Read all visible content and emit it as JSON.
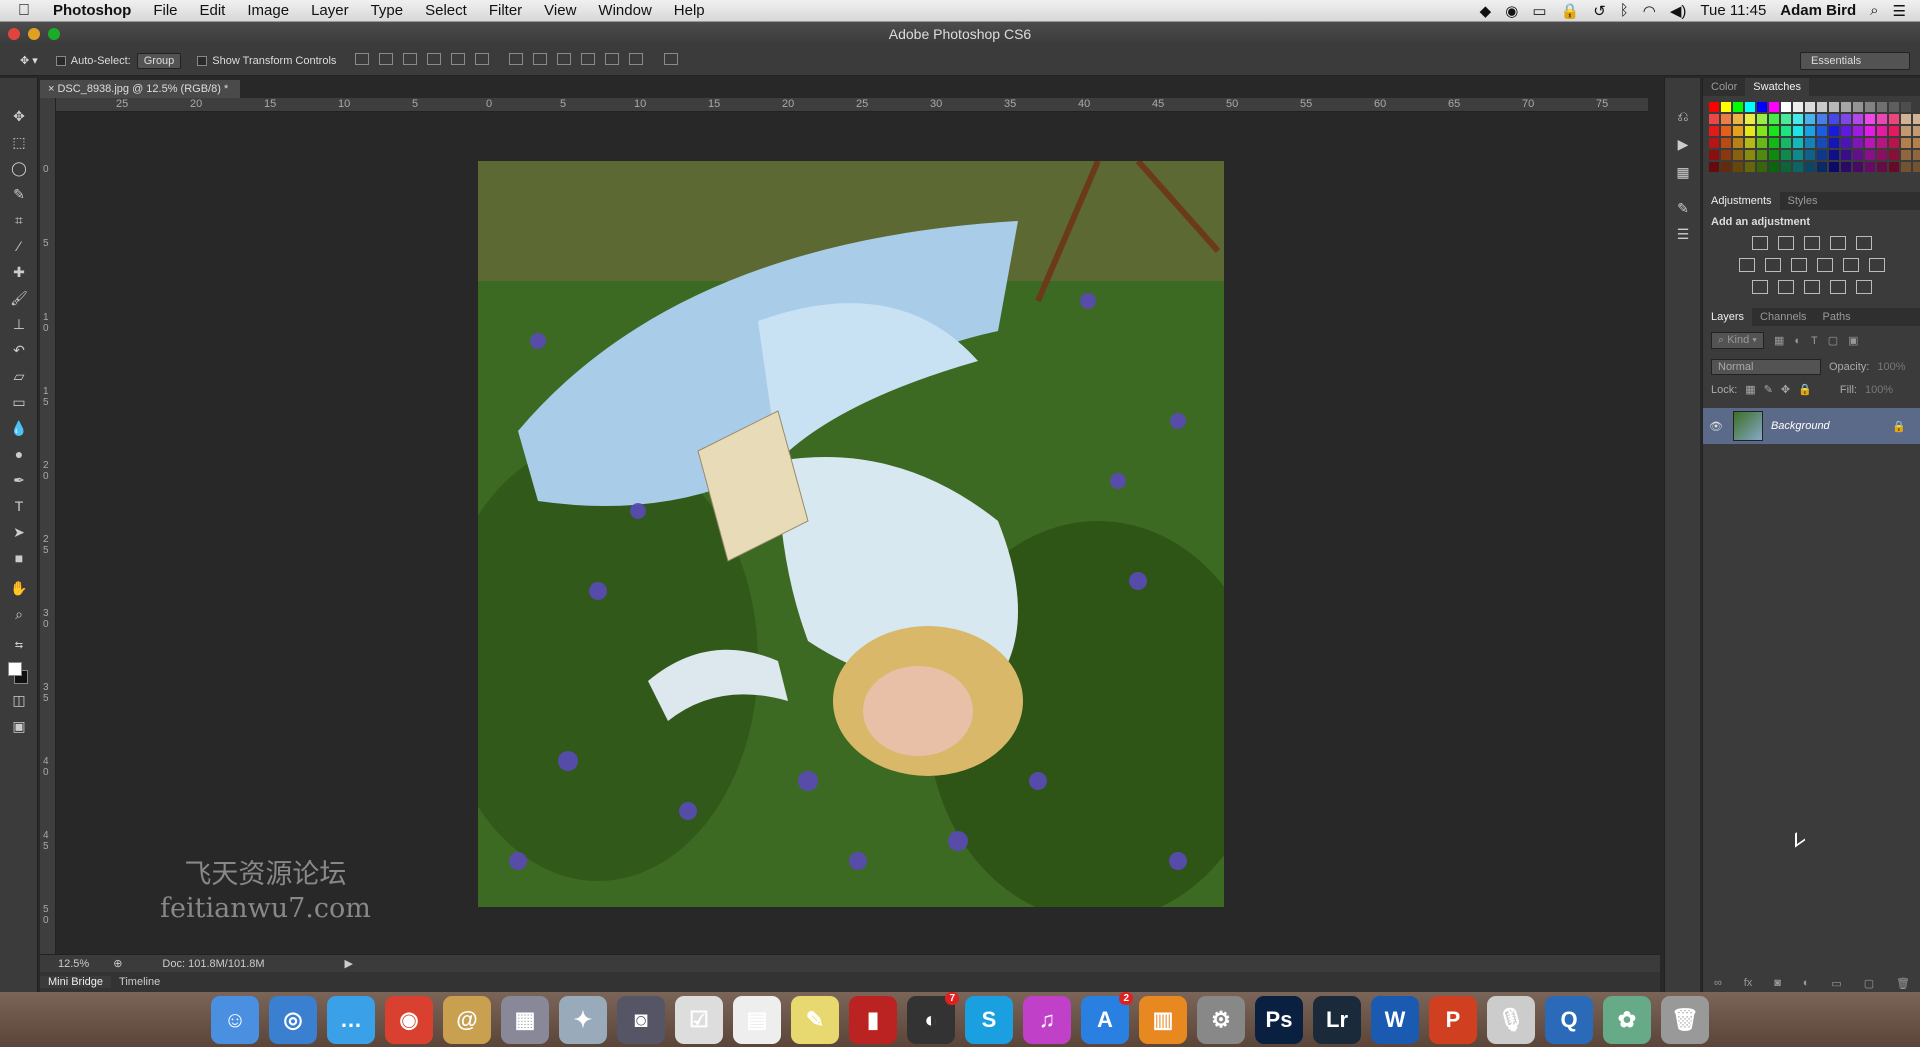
{
  "menubar": {
    "app_name": "Photoshop",
    "items": [
      "File",
      "Edit",
      "Image",
      "Layer",
      "Type",
      "Select",
      "Filter",
      "View",
      "Window",
      "Help"
    ],
    "clock": "Tue 11:45",
    "user": "Adam Bird"
  },
  "window": {
    "title": "Adobe Photoshop CS6"
  },
  "options": {
    "auto_select_label": "Auto-Select:",
    "auto_select_value": "Group",
    "transform_label": "Show Transform Controls",
    "workspace": "Essentials"
  },
  "document": {
    "tab_title": "DSC_8938.jpg @ 12.5% (RGB/8) *",
    "zoom": "12.5%",
    "doc_size": "Doc: 101.8M/101.8M"
  },
  "ruler": {
    "h_labels": [
      "25",
      "20",
      "15",
      "10",
      "5",
      "0",
      "5",
      "10",
      "15",
      "20",
      "25",
      "30",
      "35",
      "40",
      "45",
      "50",
      "55",
      "60",
      "65",
      "70",
      "75"
    ],
    "v_labels": [
      "0",
      "5",
      "1\n0",
      "1\n5",
      "2\n0",
      "2\n5",
      "3\n0",
      "3\n5",
      "4\n0",
      "4\n5",
      "5\n0"
    ]
  },
  "bottom_tabs": [
    "Mini Bridge",
    "Timeline"
  ],
  "panels": {
    "color_tabs": [
      "Color",
      "Swatches"
    ],
    "adj_tabs": [
      "Adjustments",
      "Styles"
    ],
    "adj_title": "Add an adjustment",
    "layer_tabs": [
      "Layers",
      "Channels",
      "Paths"
    ],
    "kind_label": "Kind",
    "blend_mode": "Normal",
    "opacity_label": "Opacity:",
    "opacity_value": "100%",
    "lock_label": "Lock:",
    "fill_label": "Fill:",
    "fill_value": "100%",
    "layer_name": "Background"
  },
  "watermark": {
    "line1": "飞天资源论坛",
    "line2": "feitianwu7.com"
  },
  "dock": {
    "apps": [
      {
        "name": "finder",
        "color": "#4a8fe0",
        "glyph": "☺"
      },
      {
        "name": "safari",
        "color": "#3a7fd0",
        "glyph": "◎"
      },
      {
        "name": "messages",
        "color": "#3aa0e8",
        "glyph": "…"
      },
      {
        "name": "chrome",
        "color": "#d94030",
        "glyph": "◉"
      },
      {
        "name": "mail",
        "color": "#c8a050",
        "glyph": "@"
      },
      {
        "name": "photos",
        "color": "#889",
        "glyph": "▦"
      },
      {
        "name": "preview",
        "color": "#9ab",
        "glyph": "✦"
      },
      {
        "name": "camera",
        "color": "#556",
        "glyph": "◙"
      },
      {
        "name": "notes",
        "color": "#ddd",
        "glyph": "☑"
      },
      {
        "name": "calendar",
        "color": "#eee",
        "glyph": "▤"
      },
      {
        "name": "stickies",
        "color": "#e8d870",
        "glyph": "✎"
      },
      {
        "name": "photobooth",
        "color": "#b22",
        "glyph": "▮"
      },
      {
        "name": "facetime",
        "color": "#333",
        "glyph": "◐",
        "badge": "7"
      },
      {
        "name": "skype",
        "color": "#1aa0e0",
        "glyph": "S"
      },
      {
        "name": "itunes",
        "color": "#c040c8",
        "glyph": "♫"
      },
      {
        "name": "appstore",
        "color": "#2a80e0",
        "glyph": "A",
        "badge": "2"
      },
      {
        "name": "ibooks",
        "color": "#e88820",
        "glyph": "▥"
      },
      {
        "name": "preferences",
        "color": "#888",
        "glyph": "⚙"
      },
      {
        "name": "photoshop",
        "color": "#0a2040",
        "glyph": "Ps"
      },
      {
        "name": "lightroom",
        "color": "#1a2a3a",
        "glyph": "Lr"
      },
      {
        "name": "word",
        "color": "#1a5ab0",
        "glyph": "W"
      },
      {
        "name": "powerpoint",
        "color": "#d04020",
        "glyph": "P"
      },
      {
        "name": "microphone",
        "color": "#ccc",
        "glyph": "🎙"
      },
      {
        "name": "quicktime",
        "color": "#2a6ab8",
        "glyph": "Q"
      },
      {
        "name": "iphoto",
        "color": "#6a8",
        "glyph": "✿"
      },
      {
        "name": "trash",
        "color": "#999",
        "glyph": "🗑"
      }
    ]
  }
}
